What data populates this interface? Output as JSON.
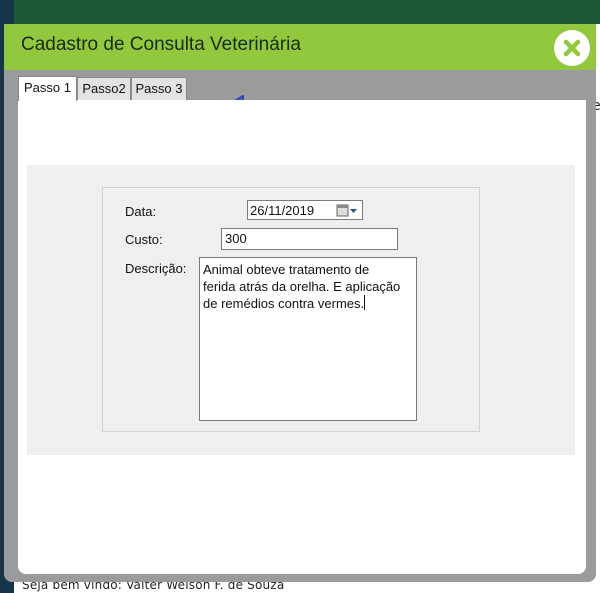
{
  "background": {
    "footer_text": "Seja bem vindo: Valter Welson F. de Souza",
    "right_char": "e"
  },
  "modal": {
    "title": "Cadastro de Consulta Veterinária",
    "close_icon": "close-x-icon",
    "header_color": "#92c83e"
  },
  "tabs": [
    {
      "label": "Passo 1",
      "active": true
    },
    {
      "label": "Passo2",
      "active": false
    },
    {
      "label": "Passo 3",
      "active": false
    }
  ],
  "annotation": {
    "arrow_color": "#4b63d6",
    "arrow_icon": "left-arrow-icon"
  },
  "form": {
    "data_label": "Data:",
    "data_value": "26/11/2019",
    "calendar_icon": "calendar-dropdown-icon",
    "custo_label": "Custo:",
    "custo_value": "300",
    "descricao_label": "Descrição:",
    "descricao_value": "Animal obteve tratamento de\nferida atrás da orelha. E aplicação\nde remédios contra vermes."
  }
}
